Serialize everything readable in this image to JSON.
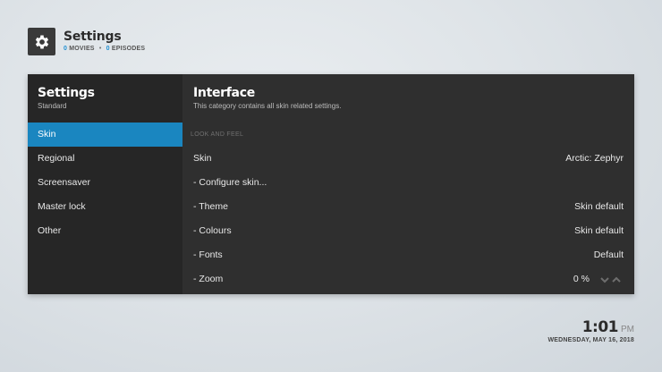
{
  "header": {
    "title": "Settings",
    "movies_count": "0",
    "movies_label": "MOVIES",
    "separator": "•",
    "episodes_count": "0",
    "episodes_label": "EPISODES",
    "icon": "gear-icon"
  },
  "sidebar": {
    "title": "Settings",
    "subtitle": "Standard",
    "items": [
      {
        "label": "Skin",
        "active": true
      },
      {
        "label": "Regional"
      },
      {
        "label": "Screensaver"
      },
      {
        "label": "Master lock"
      },
      {
        "label": "Other"
      }
    ]
  },
  "content": {
    "title": "Interface",
    "description": "This category contains all skin related settings.",
    "section": "LOOK AND FEEL",
    "rows": [
      {
        "label": "Skin",
        "value": "Arctic: Zephyr"
      },
      {
        "label": "- Configure skin...",
        "value": ""
      },
      {
        "label": "- Theme",
        "value": "Skin default"
      },
      {
        "label": "- Colours",
        "value": "Skin default"
      },
      {
        "label": "- Fonts",
        "value": "Default"
      },
      {
        "label": "- Zoom",
        "value": "0 %"
      }
    ]
  },
  "clock": {
    "time": "1:01",
    "ampm": "PM",
    "date": "WEDNESDAY, MAY 16, 2018"
  },
  "colors": {
    "accent": "#1a86c0",
    "count_blue": "#1f8fd1",
    "panel": "#2f2f2f",
    "sidebar": "#262626"
  }
}
